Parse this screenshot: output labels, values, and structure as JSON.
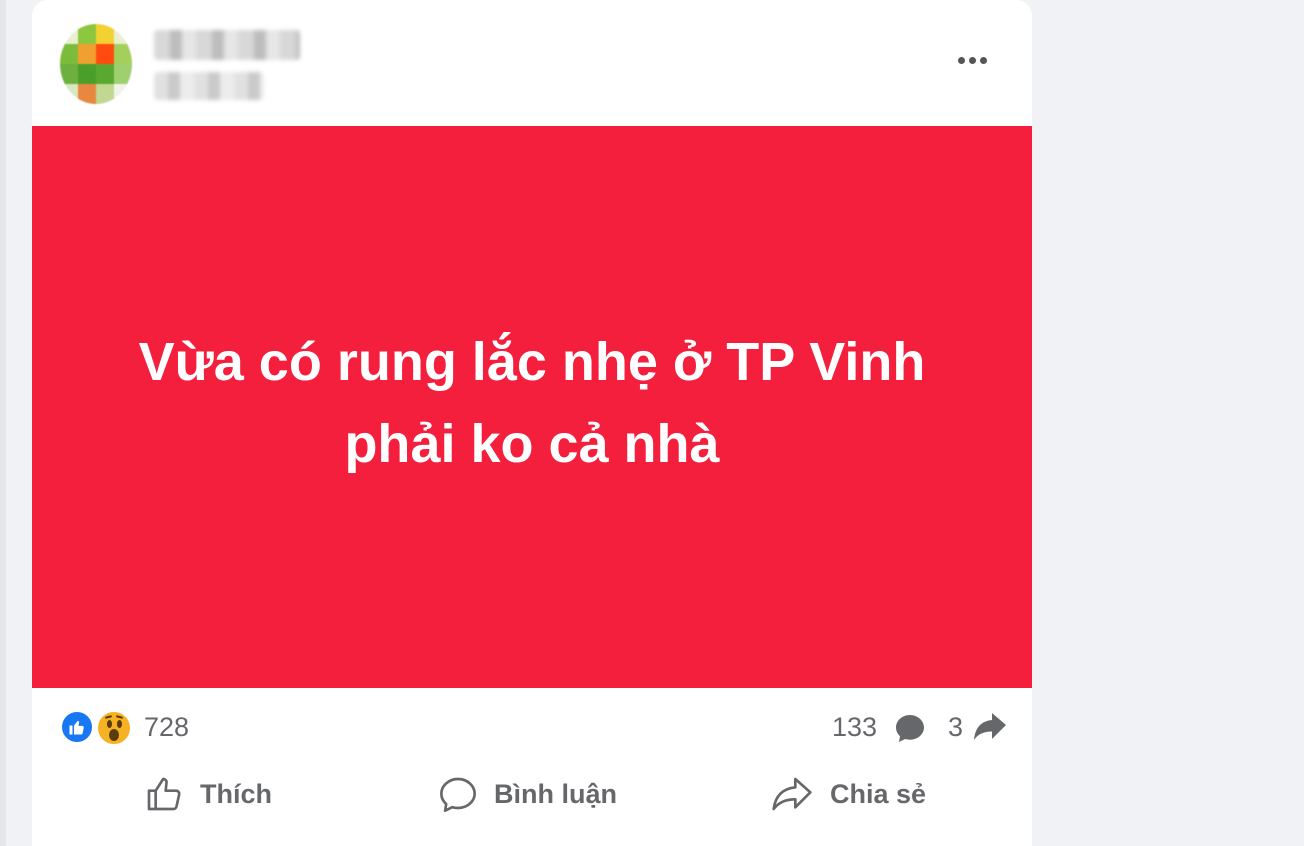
{
  "post": {
    "text_line1": "Vừa có rung lắc nhẹ ở TP Vinh",
    "text_line2": "phải ko cả nhà",
    "background_color": "#f41e3d",
    "reaction_count": "728",
    "reactions": [
      "like-icon",
      "wow-icon"
    ],
    "comment_count": "133",
    "share_count": "3"
  },
  "actions": {
    "like_label": "Thích",
    "comment_label": "Bình luận",
    "share_label": "Chia sẻ"
  },
  "icons": {
    "more": "more-options-icon",
    "comment": "comment-icon",
    "share": "share-icon"
  }
}
